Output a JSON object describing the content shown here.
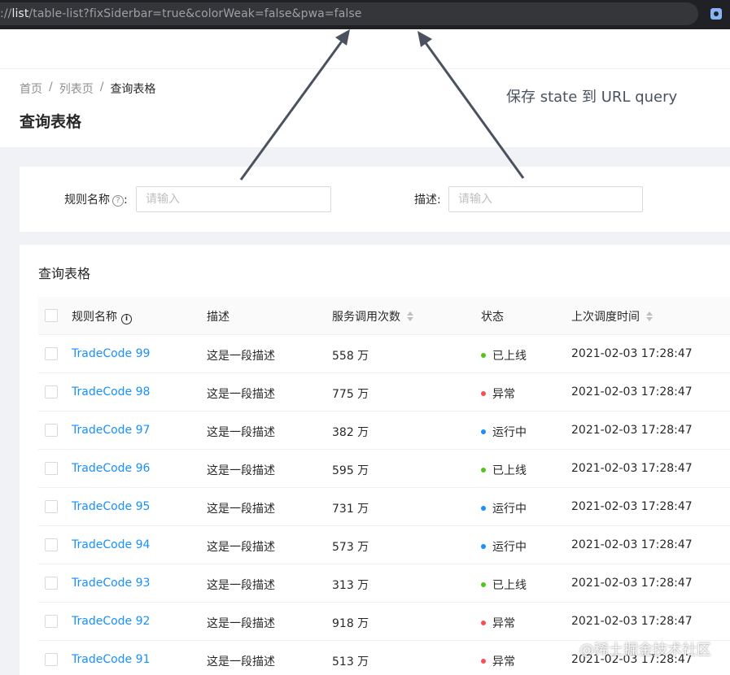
{
  "browser": {
    "url_prefix": "://",
    "url_highlight": "list",
    "url_rest": "/table-list?fixSiderbar=true&colorWeak=false&pwa=false"
  },
  "breadcrumb": [
    "首页",
    "列表页",
    "查询表格"
  ],
  "breadcrumb_separator": "/",
  "page_title": "查询表格",
  "annotation": "保存 state 到 URL query",
  "search_form": {
    "rule_name_label": "规则名称",
    "rule_name_help": "?",
    "rule_name_colon": ":",
    "rule_name_placeholder": "请输入",
    "desc_label": "描述",
    "desc_colon": ":",
    "desc_placeholder": "请输入"
  },
  "table": {
    "title": "查询表格",
    "columns": {
      "name": "规则名称",
      "name_info": "i",
      "desc": "描述",
      "calls": "服务调用次数",
      "status": "状态",
      "updated": "上次调度时间"
    },
    "rows": [
      {
        "name": "TradeCode 99",
        "desc": "这是一段描述",
        "calls": "558 万",
        "status": "已上线",
        "status_color": "#52c41a",
        "updated": "2021-02-03 17:28:47"
      },
      {
        "name": "TradeCode 98",
        "desc": "这是一段描述",
        "calls": "775 万",
        "status": "异常",
        "status_color": "#ff4d4f",
        "updated": "2021-02-03 17:28:47"
      },
      {
        "name": "TradeCode 97",
        "desc": "这是一段描述",
        "calls": "382 万",
        "status": "运行中",
        "status_color": "#1890ff",
        "updated": "2021-02-03 17:28:47"
      },
      {
        "name": "TradeCode 96",
        "desc": "这是一段描述",
        "calls": "595 万",
        "status": "已上线",
        "status_color": "#52c41a",
        "updated": "2021-02-03 17:28:47"
      },
      {
        "name": "TradeCode 95",
        "desc": "这是一段描述",
        "calls": "731 万",
        "status": "运行中",
        "status_color": "#1890ff",
        "updated": "2021-02-03 17:28:47"
      },
      {
        "name": "TradeCode 94",
        "desc": "这是一段描述",
        "calls": "573 万",
        "status": "运行中",
        "status_color": "#1890ff",
        "updated": "2021-02-03 17:28:47"
      },
      {
        "name": "TradeCode 93",
        "desc": "这是一段描述",
        "calls": "313 万",
        "status": "已上线",
        "status_color": "#52c41a",
        "updated": "2021-02-03 17:28:47"
      },
      {
        "name": "TradeCode 92",
        "desc": "这是一段描述",
        "calls": "918 万",
        "status": "异常",
        "status_color": "#ff4d4f",
        "updated": "2021-02-03 17:28:47"
      },
      {
        "name": "TradeCode 91",
        "desc": "这是一段描述",
        "calls": "513 万",
        "status": "异常",
        "status_color": "#ff4d4f",
        "updated": "2021-02-03 17:28:47"
      }
    ]
  },
  "watermark": "@稀土掘金技术社区"
}
